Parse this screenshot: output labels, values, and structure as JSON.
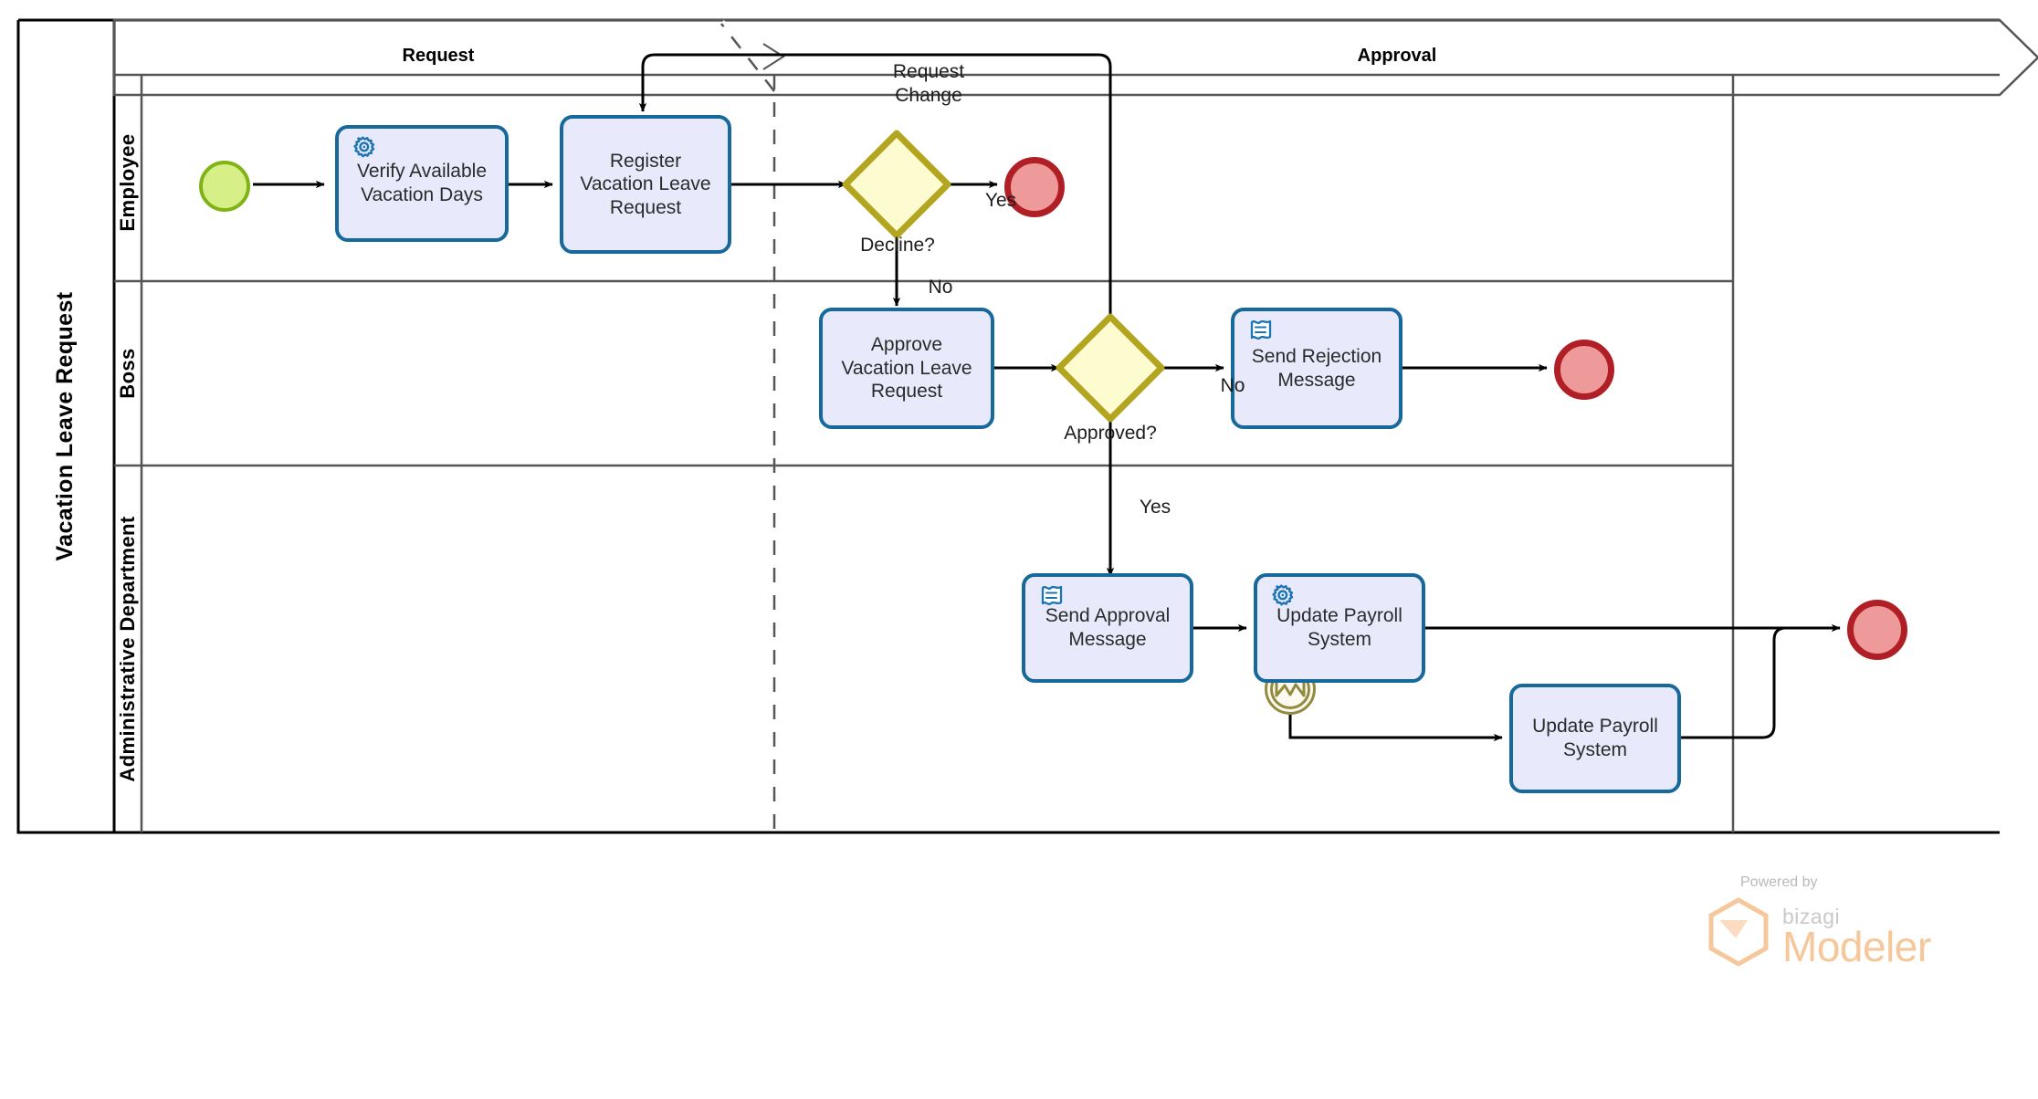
{
  "pool": {
    "name": "Vacation Leave Request"
  },
  "lanes": [
    {
      "name": "Employee"
    },
    {
      "name": "Boss"
    },
    {
      "name": "Administrative Department"
    }
  ],
  "phases": [
    {
      "name": "Request"
    },
    {
      "name": "Approval"
    }
  ],
  "events": {
    "start": {
      "name": "start-event"
    },
    "end_employee": {
      "name": "end-event"
    },
    "end_boss": {
      "name": "end-event"
    },
    "end_admin": {
      "name": "end-event"
    },
    "boundary_payroll": {
      "name": "boundary-event-signal"
    }
  },
  "tasks": [
    {
      "id": "verify",
      "label": "Verify Available\nVacation Days",
      "marker": "service-task-gear-icon"
    },
    {
      "id": "register",
      "label": "Register\nVacation Leave\nRequest",
      "marker": "none"
    },
    {
      "id": "approve",
      "label": "Approve\nVacation Leave\nRequest",
      "marker": "none"
    },
    {
      "id": "send_rejection",
      "label": "Send Rejection\nMessage",
      "marker": "script-task-icon"
    },
    {
      "id": "send_approval",
      "label": "Send Approval\nMessage",
      "marker": "script-task-icon"
    },
    {
      "id": "update_payroll_1",
      "label": "Update Payroll\nSystem",
      "marker": "service-task-gear-icon"
    },
    {
      "id": "update_payroll_2",
      "label": "Update Payroll\nSystem",
      "marker": "none"
    }
  ],
  "gateways": [
    {
      "id": "decline",
      "label": "Decline?"
    },
    {
      "id": "approved",
      "label": "Approved?"
    }
  ],
  "flow_labels": [
    {
      "id": "request_change",
      "text": "Request\nChange"
    },
    {
      "id": "decline_yes",
      "text": "Yes"
    },
    {
      "id": "decline_no",
      "text": "No"
    },
    {
      "id": "approved_no",
      "text": "No"
    },
    {
      "id": "approved_yes",
      "text": "Yes"
    }
  ],
  "branding": {
    "powered_by": "Powered by",
    "product_prefix": "bizagi",
    "product_name": "Modeler"
  },
  "colors": {
    "task_fill": "#e8eafb",
    "task_border": "#17699b",
    "gateway_fill": "#fdfbd0",
    "gateway_border": "#b3a51f",
    "start_fill": "#d6ef86",
    "start_border": "#7fb316",
    "end_fill": "#ef9a9a",
    "end_border": "#b11f26",
    "boundary_border": "#938a41",
    "lane_border": "#555555",
    "pool_border": "#000000",
    "brand_orange": "#f6c79a"
  }
}
